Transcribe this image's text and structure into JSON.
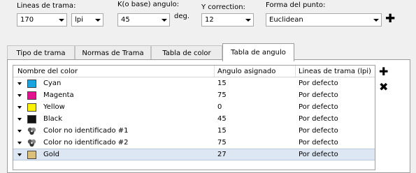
{
  "toolbar": {
    "lpi_label": "Lineas de trama:",
    "lpi_value": "170",
    "unit_value": "lpi",
    "k_angle_label": "K(o base) angulo:",
    "k_angle_value": "45",
    "deg_label": "deg.",
    "y_correction_label": "Y correction:",
    "y_correction_value": "12",
    "dot_shape_label": "Forma del punto:",
    "dot_shape_value": "Euclidean"
  },
  "tabs": [
    {
      "label": "Tipo de trama"
    },
    {
      "label": "Normas de Trama"
    },
    {
      "label": "Tabla de color"
    },
    {
      "label": "Tabla de angulo"
    }
  ],
  "table": {
    "columns": [
      "Nombre del color",
      "Angulo asignado",
      "Lineas de trama (lpi)"
    ],
    "rows": [
      {
        "name": "Cyan",
        "angle": "15",
        "lpi": "Por defecto",
        "swatch": "#1aa3e0"
      },
      {
        "name": "Magenta",
        "angle": "75",
        "lpi": "Por defecto",
        "swatch": "#e2118f"
      },
      {
        "name": "Yellow",
        "angle": "0",
        "lpi": "Por defecto",
        "swatch": "#fff200"
      },
      {
        "name": "Black",
        "angle": "45",
        "lpi": "Por defecto",
        "swatch": "#111111"
      },
      {
        "name": "Color no identificado #1",
        "angle": "15",
        "lpi": "Por defecto",
        "icon": "unidentified-color-icon"
      },
      {
        "name": "Color no identificado #2",
        "angle": "75",
        "lpi": "Por defecto",
        "icon": "unidentified-color-icon"
      },
      {
        "name": "Gold",
        "angle": "27",
        "lpi": "Por defecto",
        "swatch": "#dcc07a",
        "selected": true
      }
    ]
  },
  "colors": {
    "selection_bg": "#dde7f3",
    "panel_bg": "#ffffff",
    "window_bg": "#f0f0f0"
  },
  "icons": {
    "add_dot_shape": "plus-icon",
    "add_row": "plus-icon",
    "remove_row": "x-icon"
  }
}
